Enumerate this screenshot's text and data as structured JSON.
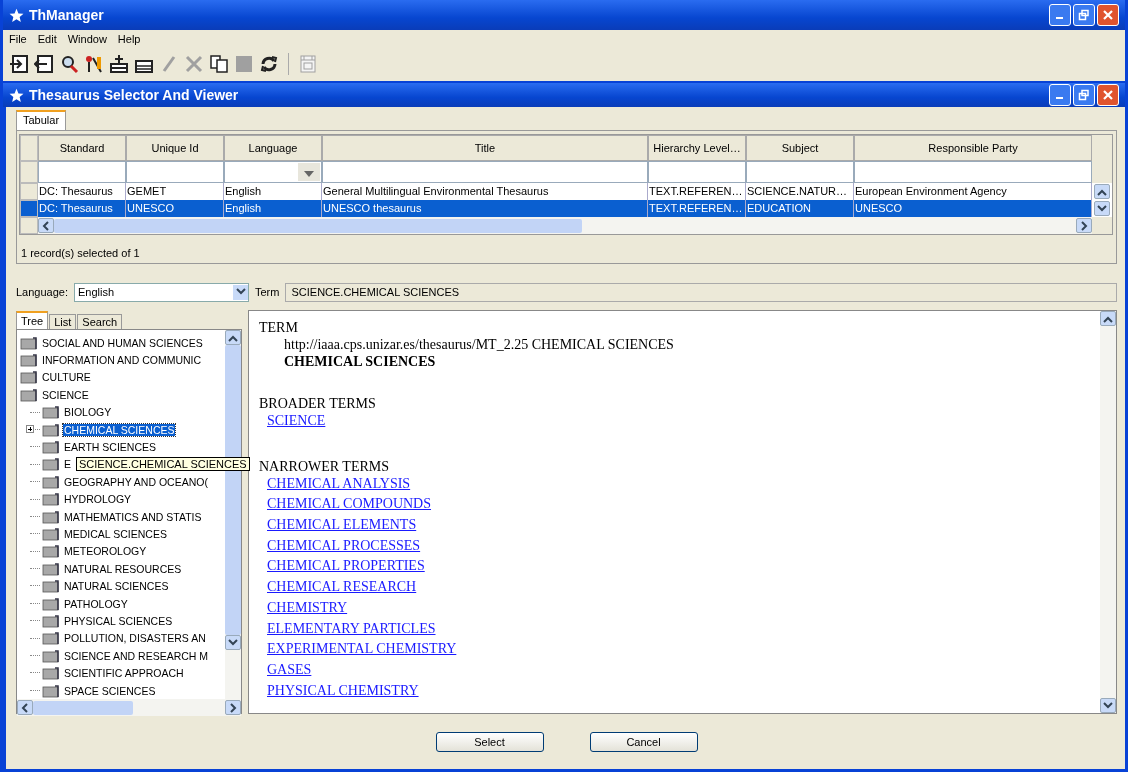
{
  "window": {
    "title": "ThManager"
  },
  "menu": [
    "File",
    "Edit",
    "Window",
    "Help"
  ],
  "toolbar": [
    {
      "kind": "import",
      "disabled": false
    },
    {
      "kind": "export",
      "disabled": false
    },
    {
      "kind": "search",
      "disabled": false
    },
    {
      "kind": "tools",
      "disabled": false
    },
    {
      "kind": "add-row",
      "disabled": false
    },
    {
      "kind": "remove-row",
      "disabled": false
    },
    {
      "kind": "pencil",
      "disabled": true
    },
    {
      "kind": "delete",
      "disabled": true
    },
    {
      "kind": "copy",
      "disabled": false
    },
    {
      "kind": "save",
      "disabled": true
    },
    {
      "kind": "refresh",
      "disabled": false
    },
    {
      "kind": "separator"
    },
    {
      "kind": "dc",
      "disabled": true
    }
  ],
  "inner_window": {
    "title": "Thesaurus Selector And Viewer"
  },
  "tabs": [
    {
      "label": "Tabular",
      "selected": true
    }
  ],
  "table": {
    "columns": [
      {
        "label": "Standard",
        "dropdown": false
      },
      {
        "label": "Unique Id",
        "dropdown": false
      },
      {
        "label": "Language",
        "dropdown": true
      },
      {
        "label": "Title",
        "dropdown": false
      },
      {
        "label": "Hierarchy Level…",
        "dropdown": false
      },
      {
        "label": "Subject",
        "dropdown": false
      },
      {
        "label": "Responsible Party",
        "dropdown": false
      }
    ],
    "rows": [
      {
        "selected": false,
        "cells": [
          "DC: Thesaurus",
          "GEMET",
          "English",
          "General Multilingual Environmental Thesaurus",
          "TEXT.REFEREN…",
          "SCIENCE.NATUR…",
          "European Environment Agency"
        ]
      },
      {
        "selected": true,
        "cells": [
          "DC: Thesaurus",
          "UNESCO",
          "English",
          "UNESCO thesaurus",
          "TEXT.REFEREN…",
          "EDUCATION",
          "UNESCO"
        ]
      }
    ]
  },
  "status": "1 record(s) selected of 1",
  "language": {
    "label": "Language:",
    "value": "English"
  },
  "term": {
    "label": "Term",
    "value": "SCIENCE.CHEMICAL SCIENCES"
  },
  "side_tabs": [
    {
      "label": "Tree",
      "selected": true
    },
    {
      "label": "List",
      "selected": false
    },
    {
      "label": "Search",
      "selected": false
    }
  ],
  "tree": [
    {
      "label": "SOCIAL AND HUMAN SCIENCES",
      "selected": false,
      "expandable": false
    },
    {
      "label": "INFORMATION AND COMMUNIC",
      "selected": false,
      "expandable": false
    },
    {
      "label": "CULTURE",
      "selected": false,
      "expandable": false
    },
    {
      "label": "SCIENCE",
      "selected": false,
      "expandable": false,
      "children": [
        {
          "label": "BIOLOGY",
          "selected": false,
          "expandable": false
        },
        {
          "label": "CHEMICAL SCIENCES",
          "selected": true,
          "expandable": true
        },
        {
          "label": "EARTH SCIENCES",
          "selected": false,
          "expandable": false
        },
        {
          "label": "E",
          "selected": false,
          "expandable": false
        },
        {
          "label": "GEOGRAPHY AND OCEANO(",
          "selected": false,
          "expandable": false
        },
        {
          "label": "HYDROLOGY",
          "selected": false,
          "expandable": false
        },
        {
          "label": "MATHEMATICS AND STATIS",
          "selected": false,
          "expandable": false
        },
        {
          "label": "MEDICAL SCIENCES",
          "selected": false,
          "expandable": false
        },
        {
          "label": "METEOROLOGY",
          "selected": false,
          "expandable": false
        },
        {
          "label": "NATURAL RESOURCES",
          "selected": false,
          "expandable": false
        },
        {
          "label": "NATURAL SCIENCES",
          "selected": false,
          "expandable": false
        },
        {
          "label": "PATHOLOGY",
          "selected": false,
          "expandable": false
        },
        {
          "label": "PHYSICAL SCIENCES",
          "selected": false,
          "expandable": false
        },
        {
          "label": "POLLUTION, DISASTERS AN",
          "selected": false,
          "expandable": false
        },
        {
          "label": "SCIENCE AND RESEARCH M",
          "selected": false,
          "expandable": false
        },
        {
          "label": "SCIENTIFIC APPROACH",
          "selected": false,
          "expandable": false
        },
        {
          "label": "SPACE SCIENCES",
          "selected": false,
          "expandable": false
        }
      ]
    }
  ],
  "tooltip": "SCIENCE.CHEMICAL SCIENCES",
  "detail": {
    "term_heading": "TERM",
    "uri": "http://iaaa.cps.unizar.es/thesaurus/MT_2.25 CHEMICAL SCIENCES",
    "term": "CHEMICAL SCIENCES",
    "broader_heading": "BROADER TERMS",
    "broader": [
      "SCIENCE"
    ],
    "narrower_heading": "NARROWER TERMS",
    "narrower": [
      "CHEMICAL ANALYSIS",
      "CHEMICAL COMPOUNDS",
      "CHEMICAL ELEMENTS",
      "CHEMICAL PROCESSES",
      "CHEMICAL PROPERTIES",
      "CHEMICAL RESEARCH",
      "CHEMISTRY",
      "ELEMENTARY PARTICLES",
      "EXPERIMENTAL CHEMISTRY",
      "GASES",
      "PHYSICAL CHEMISTRY"
    ]
  },
  "buttons": [
    "Select",
    "Cancel"
  ]
}
